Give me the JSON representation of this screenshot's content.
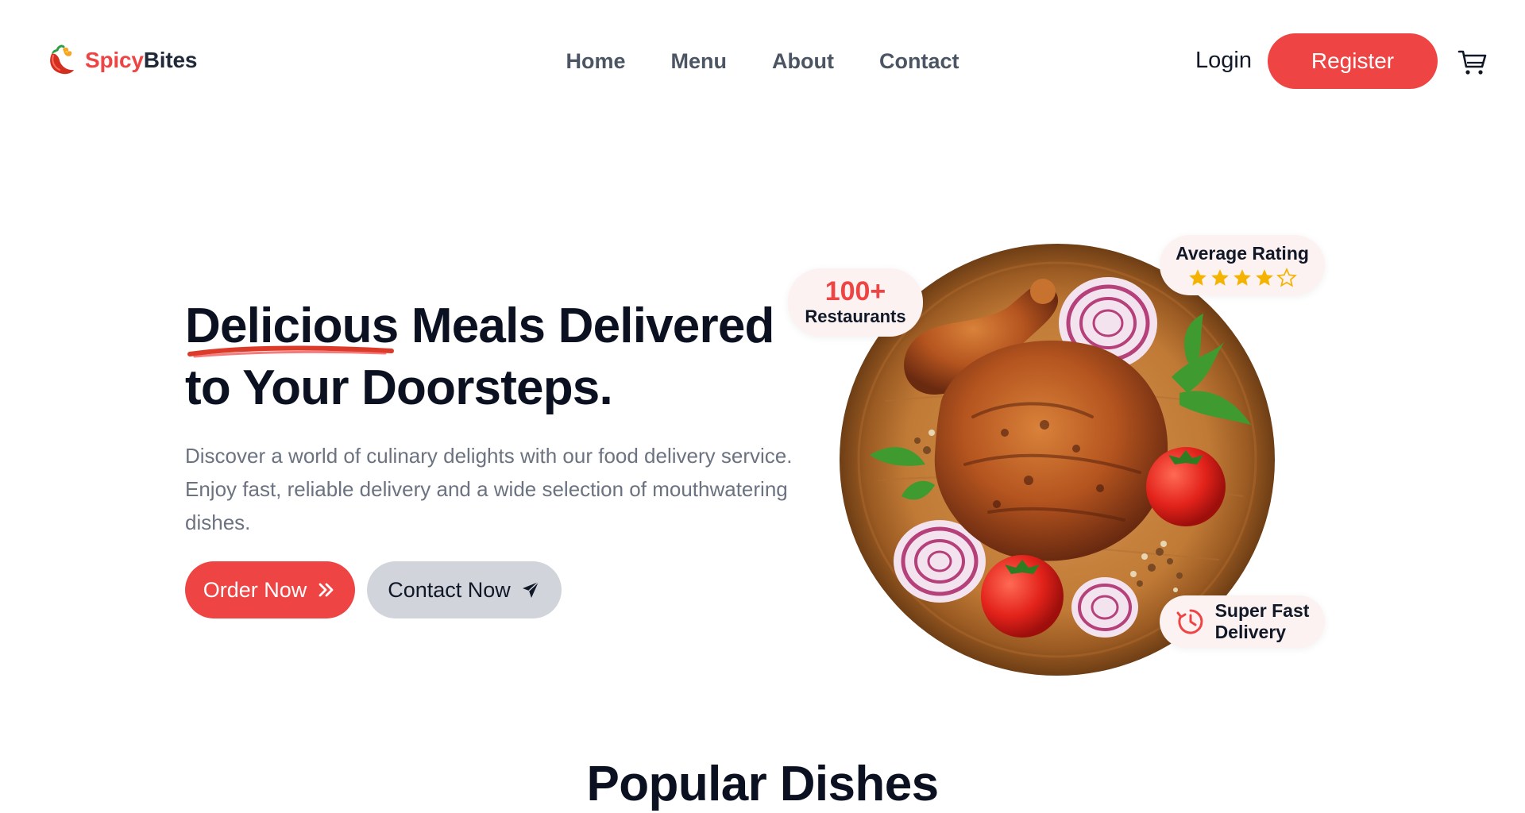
{
  "header": {
    "brand": {
      "part1": "Spicy",
      "part2": "Bites"
    },
    "nav": [
      {
        "label": "Home"
      },
      {
        "label": "Menu"
      },
      {
        "label": "About"
      },
      {
        "label": "Contact"
      }
    ],
    "login_label": "Login",
    "register_label": "Register",
    "cart_icon": "cart-icon"
  },
  "hero": {
    "title_highlight": "Delicious",
    "title_rest_line1": " Meals Delivered",
    "title_line2": "to Your Doorsteps.",
    "description": "Discover a world of culinary delights with our food delivery service. Enjoy fast, reliable delivery and a wide selection of mouthwatering dishes.",
    "order_button": {
      "label": "Order Now",
      "icon": "double-chevron-right-icon"
    },
    "contact_button": {
      "label": "Contact Now",
      "icon": "paper-plane-icon"
    }
  },
  "badges": {
    "restaurants": {
      "value": "100+",
      "label": "Restaurants"
    },
    "rating": {
      "label": "Average Rating",
      "stars_filled": 4,
      "stars_total": 5
    },
    "delivery": {
      "label": "Super Fast\nDelivery",
      "icon": "fast-delivery-clock-icon"
    }
  },
  "sections": {
    "popular_title": "Popular Dishes"
  },
  "colors": {
    "accent": "#ef4444",
    "heading": "#0b1120",
    "nav": "#4b5563",
    "muted_text": "#6b7280",
    "contact_button_bg": "#d1d5db",
    "badge_bg": "#fdf2f2",
    "star": "#f5b301"
  }
}
